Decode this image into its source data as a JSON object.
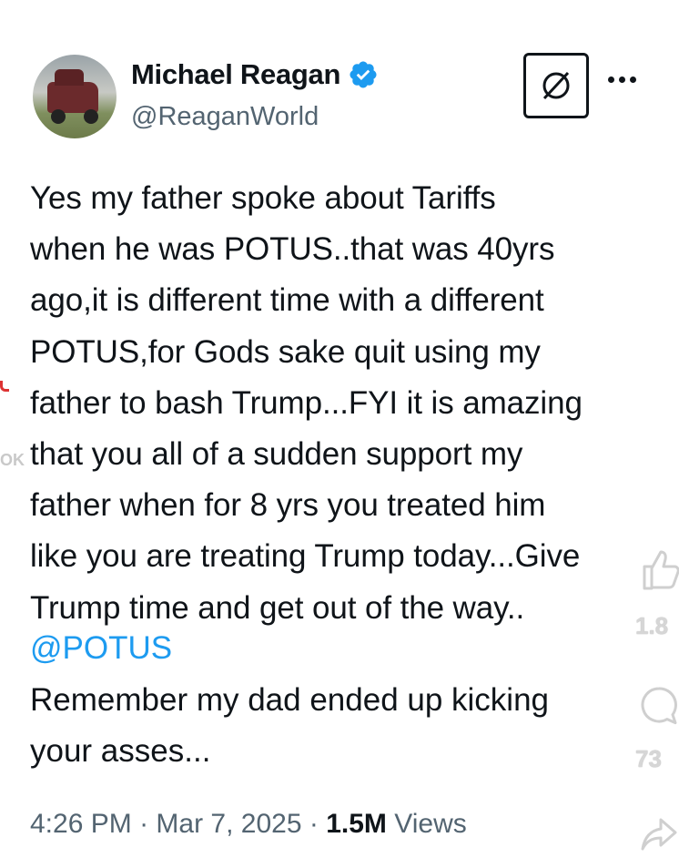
{
  "tweet": {
    "display_name": "Michael Reagan",
    "handle": "@ReaganWorld",
    "body": "Yes my father spoke about Tariffs\nwhen he was POTUS..that was 40yrs\nago,it is different time with a different\nPOTUS,for Gods sake quit using my\nfather to bash Trump...FYI it is amazing\nthat you all of a sudden support my\nfather when for 8 yrs you treated him\nlike you are treating Trump today...Give\nTrump time and get out of the way..",
    "mention": "@POTUS",
    "body_2": "Remember my dad ended up kicking\nyour asses...",
    "time": "4:26 PM",
    "date": "Mar 7, 2025",
    "views_count": "1.5M",
    "views_label": "Views",
    "separator": "·"
  },
  "overlay": {
    "like_count": "1.8",
    "comment_count": "73",
    "watermark": "OK"
  },
  "icons": {
    "verified": "verified-badge-icon",
    "grok": "grok-icon",
    "more": "more-icon",
    "like": "thumbs-up-icon",
    "comment": "comment-bubble-icon",
    "share": "share-arrow-icon"
  },
  "colors": {
    "text": "#0f1419",
    "secondary": "#536471",
    "link": "#1d9bf0",
    "verified": "#1d9bf0"
  }
}
